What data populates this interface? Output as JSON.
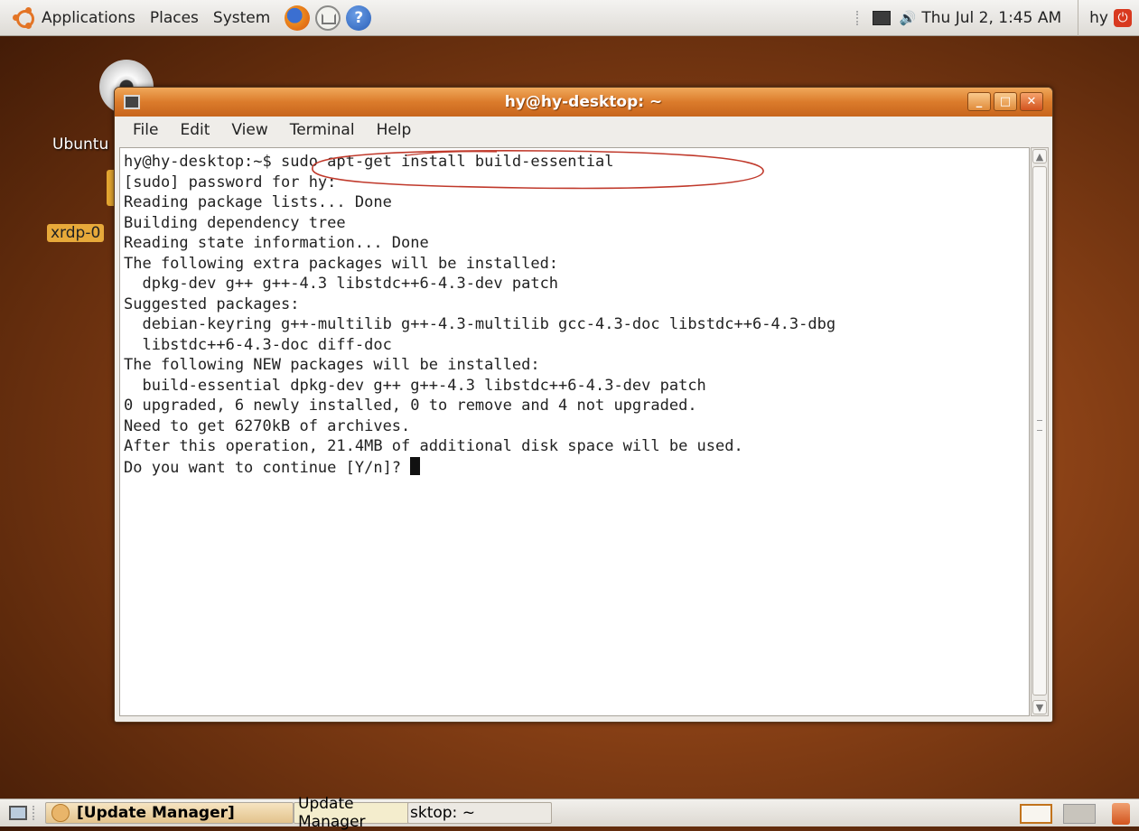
{
  "top_panel": {
    "menus": [
      "Applications",
      "Places",
      "System"
    ],
    "clock": "Thu Jul  2,  1:45 AM",
    "user": "hy"
  },
  "desktop": {
    "icons": [
      "Ubuntu",
      "xrdp-0"
    ]
  },
  "window": {
    "title": "hy@hy-desktop: ~",
    "menus": [
      "File",
      "Edit",
      "View",
      "Terminal",
      "Help"
    ],
    "terminal_lines": [
      "hy@hy-desktop:~$ sudo apt-get install build-essential",
      "[sudo] password for hy:",
      "Reading package lists... Done",
      "Building dependency tree",
      "Reading state information... Done",
      "The following extra packages will be installed:",
      "  dpkg-dev g++ g++-4.3 libstdc++6-4.3-dev patch",
      "Suggested packages:",
      "  debian-keyring g++-multilib g++-4.3-multilib gcc-4.3-doc libstdc++6-4.3-dbg",
      "  libstdc++6-4.3-doc diff-doc",
      "The following NEW packages will be installed:",
      "  build-essential dpkg-dev g++ g++-4.3 libstdc++6-4.3-dev patch",
      "0 upgraded, 6 newly installed, 0 to remove and 4 not upgraded.",
      "Need to get 6270kB of archives.",
      "After this operation, 21.4MB of additional disk space will be used."
    ],
    "prompt_line": "Do you want to continue [Y/n]? "
  },
  "taskbar": {
    "tasks": [
      "[Update Manager]",
      "Update Manager",
      "sktop: ~"
    ]
  },
  "colors": {
    "accent": "#db7b2b",
    "annotation": "#c0392b"
  }
}
